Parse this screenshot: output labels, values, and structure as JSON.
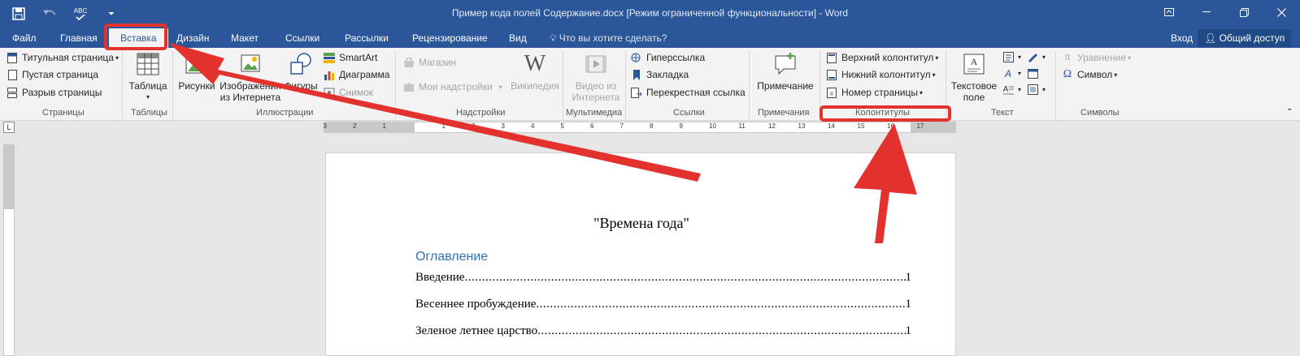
{
  "window": {
    "title": "Пример кода полей Содержание.docx [Режим ограниченной функциональности] - Word"
  },
  "qat": {
    "spell_label": "ABC"
  },
  "tabs": [
    {
      "label": "Файл"
    },
    {
      "label": "Главная"
    },
    {
      "label": "Вставка"
    },
    {
      "label": "Дизайн"
    },
    {
      "label": "Макет"
    },
    {
      "label": "Ссылки"
    },
    {
      "label": "Рассылки"
    },
    {
      "label": "Рецензирование"
    },
    {
      "label": "Вид"
    }
  ],
  "tell_me": "Что вы хотите сделать?",
  "account": {
    "signin": "Вход",
    "share": "Общий доступ"
  },
  "ribbon": {
    "pages": {
      "cover": "Титульная страница",
      "blank": "Пустая страница",
      "break": "Разрыв страницы",
      "label": "Страницы"
    },
    "tables": {
      "table": "Таблица",
      "label": "Таблицы"
    },
    "illustrations": {
      "pictures": "Рисунки",
      "online_line1": "Изображения",
      "online_line2": "из Интернета",
      "shapes": "Фигуры",
      "smartart": "SmartArt",
      "chart": "Диаграмма",
      "screenshot": "Снимок",
      "label": "Иллюстрации"
    },
    "addins": {
      "store": "Магазин",
      "my_addins": "Мои надстройки",
      "wikipedia": "Википедия",
      "label": "Надстройки"
    },
    "media": {
      "video_line1": "Видео из",
      "video_line2": "Интернета",
      "label": "Мультимедиа"
    },
    "links": {
      "hyperlink": "Гиперссылка",
      "bookmark": "Закладка",
      "crossref": "Перекрестная ссылка",
      "label": "Ссылки"
    },
    "comments": {
      "comment": "Примечание",
      "label": "Примечания"
    },
    "headerfooter": {
      "header": "Верхний колонтитул",
      "footer": "Нижний колонтитул",
      "pagenum": "Номер страницы",
      "label": "Колонтитулы"
    },
    "text": {
      "textbox_line1": "Текстовое",
      "textbox_line2": "поле",
      "label": "Текст"
    },
    "symbols": {
      "equation": "Уравнение",
      "symbol": "Символ",
      "label": "Символы"
    }
  },
  "ruler": {
    "left_marks": [
      "3",
      "2",
      "1"
    ],
    "marks": [
      "1",
      "2",
      "3",
      "4",
      "5",
      "6",
      "7",
      "8",
      "9",
      "10",
      "11",
      "12",
      "13",
      "14",
      "15",
      "16",
      "17"
    ],
    "corner": "L"
  },
  "document": {
    "title": "\"Времена года\"",
    "toc_heading": "Оглавление",
    "toc": [
      {
        "text": "Введение",
        "page": "1"
      },
      {
        "text": "Весеннее пробуждение",
        "page": "1"
      },
      {
        "text": "Зеленое летнее царство",
        "page": "1"
      }
    ]
  },
  "colors": {
    "accent": "#2b579a",
    "annotation": "#e3312d",
    "toc_heading": "#2e74b5"
  }
}
